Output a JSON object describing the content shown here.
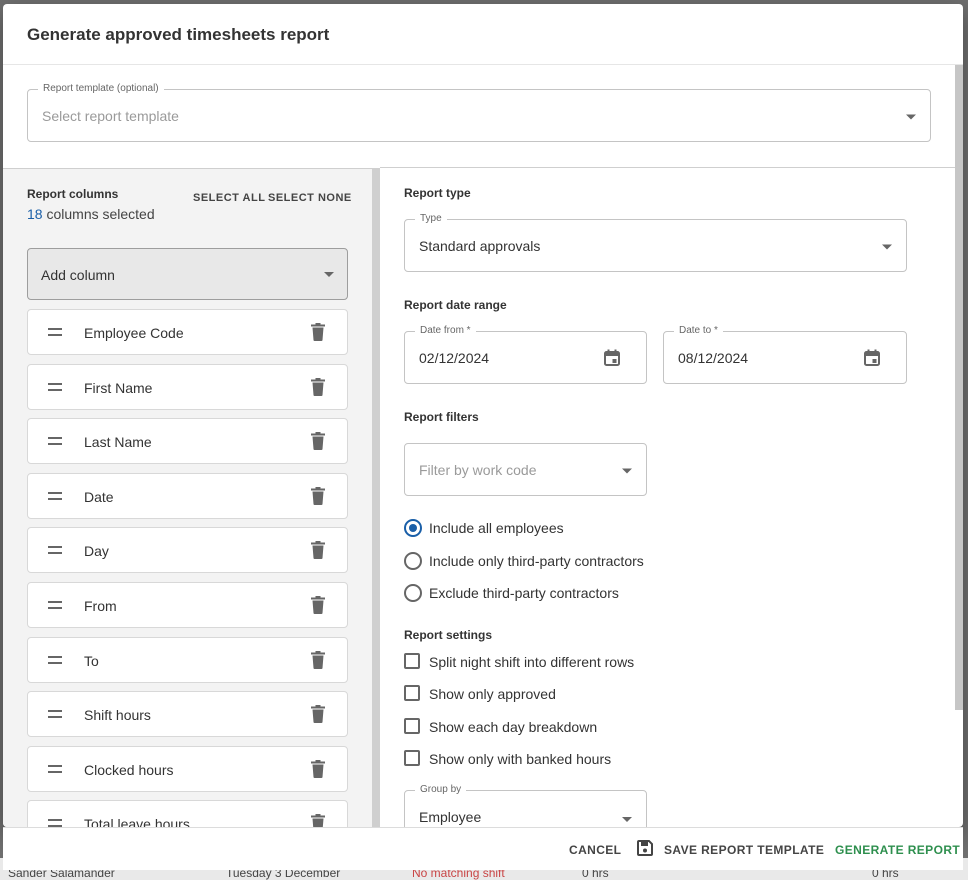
{
  "background": {
    "row_name": "Sander Salamander",
    "row_date": "Tuesday 3 December",
    "row_status": "No matching shift",
    "row_hours_1": "0 hrs",
    "row_hours_2": "0 hrs"
  },
  "dialog": {
    "title": "Generate approved timesheets report",
    "template": {
      "label": "Report template (optional)",
      "placeholder": "Select report template"
    }
  },
  "columns_panel": {
    "title": "Report columns",
    "count": "18",
    "count_suffix": "columns selected",
    "select_all": "SELECT ALL",
    "select_none": "SELECT NONE",
    "add_column": "Add column",
    "items": [
      "Employee Code",
      "First Name",
      "Last Name",
      "Date",
      "Day",
      "From",
      "To",
      "Shift hours",
      "Clocked hours",
      "Total leave hours"
    ]
  },
  "report_type": {
    "title": "Report type",
    "label": "Type",
    "value": "Standard approvals"
  },
  "date_range": {
    "title": "Report date range",
    "from_label": "Date from *",
    "from_value": "02/12/2024",
    "to_label": "Date to *",
    "to_value": "08/12/2024"
  },
  "filters": {
    "title": "Report filters",
    "work_code_placeholder": "Filter by work code",
    "options": [
      {
        "label": "Include all employees",
        "selected": true
      },
      {
        "label": "Include only third-party contractors",
        "selected": false
      },
      {
        "label": "Exclude third-party contractors",
        "selected": false
      }
    ]
  },
  "settings": {
    "title": "Report settings",
    "checkboxes": [
      {
        "label": "Split night shift into different rows",
        "checked": false
      },
      {
        "label": "Show only approved",
        "checked": false
      },
      {
        "label": "Show each day breakdown",
        "checked": false
      },
      {
        "label": "Show only with banked hours",
        "checked": false
      }
    ],
    "group_by_label": "Group by",
    "group_by_value": "Employee"
  },
  "footer": {
    "cancel": "CANCEL",
    "save_template": "SAVE REPORT TEMPLATE",
    "generate": "GENERATE REPORT"
  },
  "colors": {
    "accent_blue": "#1a5fa8",
    "accent_green": "#2e8f4e"
  }
}
